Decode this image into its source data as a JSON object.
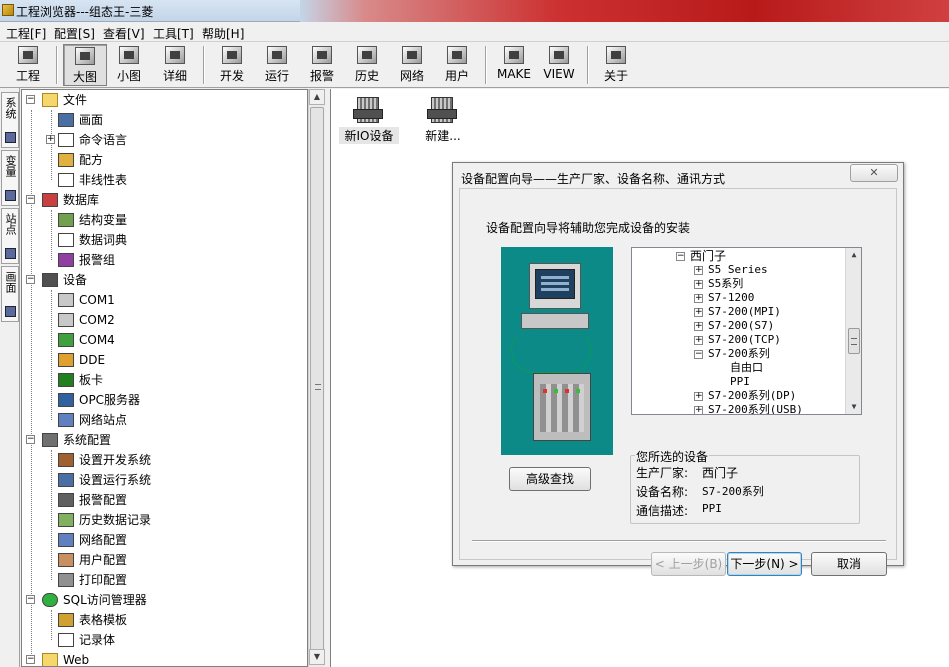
{
  "window": {
    "title": "工程浏览器---组态王-三菱"
  },
  "menu": [
    "工程[F]",
    "配置[S]",
    "查看[V]",
    "工具[T]",
    "帮助[H]"
  ],
  "toolbar": {
    "project": "工程",
    "large_icons": "大图",
    "small_icons": "小图",
    "details": "详细",
    "develop": "开发",
    "run": "运行",
    "alarm": "报警",
    "history": "历史",
    "network": "网络",
    "user": "用户",
    "make": "MAKE",
    "view": "VIEW",
    "about": "关于"
  },
  "side_tabs": [
    "系统",
    "变量",
    "站点",
    "画面"
  ],
  "tree": {
    "file": "文件",
    "screen": "画面",
    "command_language": "命令语言",
    "recipe": "配方",
    "nonlinear_table": "非线性表",
    "database": "数据库",
    "structure_variable": "结构变量",
    "data_dictionary": "数据词典",
    "alarm_group": "报警组",
    "device": "设备",
    "com1": "COM1",
    "com2": "COM2",
    "com4": "COM4",
    "dde": "DDE",
    "board": "板卡",
    "opc_server": "OPC服务器",
    "network_station": "网络站点",
    "system_config": "系统配置",
    "set_dev_system": "设置开发系统",
    "set_run_system": "设置运行系统",
    "alarm_config": "报警配置",
    "history_record": "历史数据记录",
    "network_config": "网络配置",
    "user_config": "用户配置",
    "print_config": "打印配置",
    "sql_manager": "SQL访问管理器",
    "table_template": "表格模板",
    "record_set": "记录体",
    "web": "Web"
  },
  "content": {
    "new_io_device": "新IO设备",
    "new": "新建..."
  },
  "dialog": {
    "title": "设备配置向导——生产厂家、设备名称、通讯方式",
    "intro": "设备配置向导将辅助您完成设备的安装",
    "advanced_search": "高级查找",
    "list": [
      "西门子",
      "S5 Series",
      "S5系列",
      "S7-1200",
      "S7-200(MPI)",
      "S7-200(S7)",
      "S7-200(TCP)",
      "S7-200系列",
      "自由口",
      "PPI",
      "S7-200系列(DP)",
      "S7-200系列(USB)"
    ],
    "group_title": "您所选的设备",
    "manufacturer_label": "生产厂家:",
    "manufacturer_value": "西门子",
    "device_name_label": "设备名称:",
    "device_name_value": "S7-200系列",
    "comm_label": "通信描述:",
    "comm_value": "PPI",
    "prev": "< 上一步(B)",
    "next": "下一步(N) >",
    "cancel": "取消"
  }
}
